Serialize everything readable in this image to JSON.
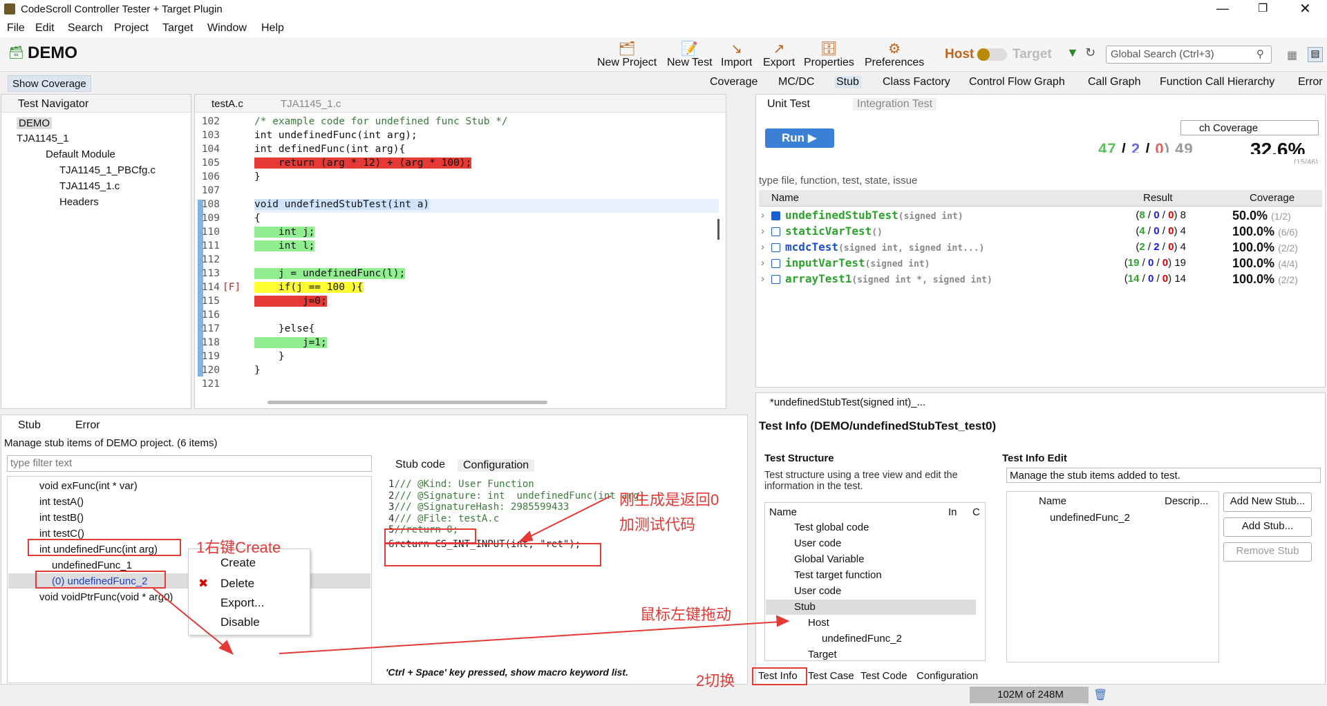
{
  "window": {
    "title": "CodeScroll Controller Tester + Target Plugin"
  },
  "menu": [
    "File",
    "Edit",
    "Search",
    "Project",
    "Target",
    "Window",
    "Help"
  ],
  "project": {
    "name": "DEMO"
  },
  "toolbar": {
    "items": [
      "New Project",
      "New Test",
      "Import",
      "Export",
      "Properties",
      "Preferences"
    ],
    "host": "Host",
    "target": "Target",
    "search_placeholder": "Global Search (Ctrl+3)"
  },
  "perspectives": {
    "show_coverage": "Show Coverage",
    "tabs": [
      "Coverage",
      "MC/DC",
      "Stub",
      "Class Factory",
      "Control Flow Graph",
      "Call Graph",
      "Function Call Hierarchy",
      "Error"
    ]
  },
  "navigator": {
    "title": "Test Navigator",
    "items": [
      "DEMO",
      "TJA1145_1",
      "Default Module",
      "TJA1145_1_PBCfg.c",
      "TJA1145_1.c",
      "Headers"
    ]
  },
  "editor": {
    "tabs": [
      "testA.c",
      "TJA1145_1.c"
    ],
    "lines": [
      {
        "n": "102",
        "text": "/* example code for undefined func Stub */",
        "kind": "comment",
        "hl": ""
      },
      {
        "n": "103",
        "text": "int undefinedFunc(int arg);",
        "kind": "code",
        "hl": ""
      },
      {
        "n": "104",
        "text": "int definedFunc(int arg){",
        "kind": "code",
        "hl": ""
      },
      {
        "n": "105",
        "text": "    return (arg * 12) + (arg * 100);",
        "kind": "code",
        "hl": "red"
      },
      {
        "n": "106",
        "text": "}",
        "kind": "code",
        "hl": ""
      },
      {
        "n": "107",
        "text": "",
        "kind": "code",
        "hl": ""
      },
      {
        "n": "108",
        "text": "void undefinedStubTest(int a)",
        "kind": "code",
        "hl": "blue"
      },
      {
        "n": "109",
        "text": "{",
        "kind": "code",
        "hl": ""
      },
      {
        "n": "110",
        "text": "    int j;",
        "kind": "code",
        "hl": "green"
      },
      {
        "n": "111",
        "text": "    int l;",
        "kind": "code",
        "hl": "green"
      },
      {
        "n": "112",
        "text": "",
        "kind": "code",
        "hl": ""
      },
      {
        "n": "113",
        "text": "    j = undefinedFunc(l);",
        "kind": "code",
        "hl": "green"
      },
      {
        "n": "114",
        "text": "    if(j == 100 ){",
        "kind": "code",
        "hl": "yellow"
      },
      {
        "n": "115",
        "text": "        j=0;",
        "kind": "code",
        "hl": "red"
      },
      {
        "n": "116",
        "text": "",
        "kind": "code",
        "hl": ""
      },
      {
        "n": "117",
        "text": "    }else{",
        "kind": "code",
        "hl": ""
      },
      {
        "n": "118",
        "text": "        j=1;",
        "kind": "code",
        "hl": "green"
      },
      {
        "n": "119",
        "text": "    }",
        "kind": "code",
        "hl": ""
      },
      {
        "n": "120",
        "text": "}",
        "kind": "code",
        "hl": ""
      },
      {
        "n": "121",
        "text": "",
        "kind": "code",
        "hl": ""
      }
    ],
    "marker_114": "[F]"
  },
  "unit": {
    "tabs": [
      "Unit Test",
      "Integration Test"
    ],
    "run": "Run",
    "coverage_combo": "ch Coverage",
    "summary": {
      "a": "47",
      "b": "2",
      "c": "0",
      "total": "49",
      "pct": "32.6%",
      "frac": "(15/46)"
    },
    "filter": "type file, function, test, state, issue",
    "cols": [
      "Name",
      "Result",
      "Coverage"
    ],
    "rows": [
      {
        "name": "undefinedStubTest",
        "sig": "(signed int)",
        "checked": true,
        "color": "green",
        "r": [
          "8",
          "0",
          "0",
          "8"
        ],
        "pct": "50.0%",
        "frac": "(1/2)"
      },
      {
        "name": "staticVarTest",
        "sig": "()",
        "checked": false,
        "color": "green",
        "r": [
          "4",
          "0",
          "0",
          "4"
        ],
        "pct": "100.0%",
        "frac": "(6/6)"
      },
      {
        "name": "mcdcTest",
        "sig": "(signed int, signed int...)",
        "checked": false,
        "color": "blue",
        "r": [
          "2",
          "2",
          "0",
          "4"
        ],
        "pct": "100.0%",
        "frac": "(2/2)"
      },
      {
        "name": "inputVarTest",
        "sig": "(signed int)",
        "checked": false,
        "color": "green",
        "r": [
          "19",
          "0",
          "0",
          "19"
        ],
        "pct": "100.0%",
        "frac": "(4/4)"
      },
      {
        "name": "arrayTest1",
        "sig": "(signed int *, signed int)",
        "checked": false,
        "color": "green",
        "r": [
          "14",
          "0",
          "0",
          "14"
        ],
        "pct": "100.0%",
        "frac": "(2/2)"
      }
    ]
  },
  "stub": {
    "tabs": [
      "Stub",
      "Error"
    ],
    "desc": "Manage stub items of DEMO project. (6 items)",
    "filter": "type filter text",
    "items": [
      "void  exFunc(int * var)",
      "int  testA()",
      "int  testB()",
      "int  testC()",
      "int  undefinedFunc(int arg)",
      "undefinedFunc_1",
      "(0) undefinedFunc_2",
      "void  voidPtrFunc(void * arg0)"
    ],
    "code_tabs": [
      "Stub code",
      "Configuration"
    ],
    "code": [
      {
        "n": "1",
        "text": "/// @Kind: User Function"
      },
      {
        "n": "2",
        "text": "/// @Signature: int  undefinedFunc(int arg)"
      },
      {
        "n": "3",
        "text": "/// @SignatureHash: 2985599433"
      },
      {
        "n": "4",
        "text": "/// @File: testA.c"
      },
      {
        "n": "5",
        "text": "//return 0;"
      },
      {
        "n": "6",
        "text": "return CS_INT_INPUT(int, \"ret\");"
      }
    ],
    "status": "'Ctrl + Space' key pressed, show macro keyword list."
  },
  "context_menu": [
    "Create",
    "Delete",
    "Export...",
    "Disable"
  ],
  "annotations": {
    "a1": "1右键Create",
    "a2": "2切换",
    "a3": "刚生成是返回0",
    "a4": "加测试代码",
    "a5": "鼠标左键拖动"
  },
  "testinfo": {
    "tab": "*undefinedStubTest(signed int)_...",
    "title": "Test Info (DEMO/undefinedStubTest_test0)",
    "structure_title": "Test Structure",
    "structure_desc": "Test structure using a tree view and edit the information in the test.",
    "cols": [
      "Name",
      "In",
      "C"
    ],
    "tree": [
      "Test global code",
      "User code",
      "Global Variable",
      "Test target function",
      "User code",
      "Stub",
      "Host",
      "undefinedFunc_2",
      "Target"
    ],
    "edit_title": "Test Info Edit",
    "edit_desc": "Manage the stub items added to test.",
    "edit_cols": [
      "Name",
      "Descrip..."
    ],
    "edit_item": "undefinedFunc_2",
    "buttons": [
      "Add New Stub...",
      "Add Stub...",
      "Remove Stub"
    ],
    "bottom_tabs": [
      "Test Info",
      "Test Case",
      "Test Code",
      "Configuration"
    ]
  },
  "memory": "102M of 248M",
  "colors": {
    "accent": "#3c7fd6",
    "covered": "#90ee90",
    "uncovered": "#e53935",
    "partial": "#ffff33",
    "annotation": "#e53935"
  }
}
